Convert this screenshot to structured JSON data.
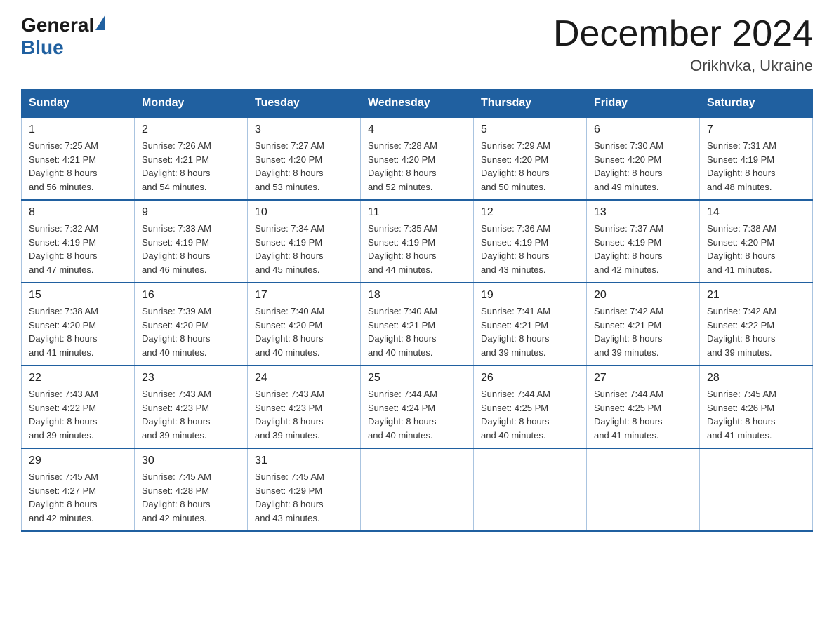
{
  "logo": {
    "general": "General",
    "blue": "Blue",
    "triangle": "▶"
  },
  "title": "December 2024",
  "location": "Orikhvka, Ukraine",
  "days_of_week": [
    "Sunday",
    "Monday",
    "Tuesday",
    "Wednesday",
    "Thursday",
    "Friday",
    "Saturday"
  ],
  "weeks": [
    [
      {
        "day": "1",
        "sunrise": "7:25 AM",
        "sunset": "4:21 PM",
        "daylight": "8 hours and 56 minutes."
      },
      {
        "day": "2",
        "sunrise": "7:26 AM",
        "sunset": "4:21 PM",
        "daylight": "8 hours and 54 minutes."
      },
      {
        "day": "3",
        "sunrise": "7:27 AM",
        "sunset": "4:20 PM",
        "daylight": "8 hours and 53 minutes."
      },
      {
        "day": "4",
        "sunrise": "7:28 AM",
        "sunset": "4:20 PM",
        "daylight": "8 hours and 52 minutes."
      },
      {
        "day": "5",
        "sunrise": "7:29 AM",
        "sunset": "4:20 PM",
        "daylight": "8 hours and 50 minutes."
      },
      {
        "day": "6",
        "sunrise": "7:30 AM",
        "sunset": "4:20 PM",
        "daylight": "8 hours and 49 minutes."
      },
      {
        "day": "7",
        "sunrise": "7:31 AM",
        "sunset": "4:19 PM",
        "daylight": "8 hours and 48 minutes."
      }
    ],
    [
      {
        "day": "8",
        "sunrise": "7:32 AM",
        "sunset": "4:19 PM",
        "daylight": "8 hours and 47 minutes."
      },
      {
        "day": "9",
        "sunrise": "7:33 AM",
        "sunset": "4:19 PM",
        "daylight": "8 hours and 46 minutes."
      },
      {
        "day": "10",
        "sunrise": "7:34 AM",
        "sunset": "4:19 PM",
        "daylight": "8 hours and 45 minutes."
      },
      {
        "day": "11",
        "sunrise": "7:35 AM",
        "sunset": "4:19 PM",
        "daylight": "8 hours and 44 minutes."
      },
      {
        "day": "12",
        "sunrise": "7:36 AM",
        "sunset": "4:19 PM",
        "daylight": "8 hours and 43 minutes."
      },
      {
        "day": "13",
        "sunrise": "7:37 AM",
        "sunset": "4:19 PM",
        "daylight": "8 hours and 42 minutes."
      },
      {
        "day": "14",
        "sunrise": "7:38 AM",
        "sunset": "4:20 PM",
        "daylight": "8 hours and 41 minutes."
      }
    ],
    [
      {
        "day": "15",
        "sunrise": "7:38 AM",
        "sunset": "4:20 PM",
        "daylight": "8 hours and 41 minutes."
      },
      {
        "day": "16",
        "sunrise": "7:39 AM",
        "sunset": "4:20 PM",
        "daylight": "8 hours and 40 minutes."
      },
      {
        "day": "17",
        "sunrise": "7:40 AM",
        "sunset": "4:20 PM",
        "daylight": "8 hours and 40 minutes."
      },
      {
        "day": "18",
        "sunrise": "7:40 AM",
        "sunset": "4:21 PM",
        "daylight": "8 hours and 40 minutes."
      },
      {
        "day": "19",
        "sunrise": "7:41 AM",
        "sunset": "4:21 PM",
        "daylight": "8 hours and 39 minutes."
      },
      {
        "day": "20",
        "sunrise": "7:42 AM",
        "sunset": "4:21 PM",
        "daylight": "8 hours and 39 minutes."
      },
      {
        "day": "21",
        "sunrise": "7:42 AM",
        "sunset": "4:22 PM",
        "daylight": "8 hours and 39 minutes."
      }
    ],
    [
      {
        "day": "22",
        "sunrise": "7:43 AM",
        "sunset": "4:22 PM",
        "daylight": "8 hours and 39 minutes."
      },
      {
        "day": "23",
        "sunrise": "7:43 AM",
        "sunset": "4:23 PM",
        "daylight": "8 hours and 39 minutes."
      },
      {
        "day": "24",
        "sunrise": "7:43 AM",
        "sunset": "4:23 PM",
        "daylight": "8 hours and 39 minutes."
      },
      {
        "day": "25",
        "sunrise": "7:44 AM",
        "sunset": "4:24 PM",
        "daylight": "8 hours and 40 minutes."
      },
      {
        "day": "26",
        "sunrise": "7:44 AM",
        "sunset": "4:25 PM",
        "daylight": "8 hours and 40 minutes."
      },
      {
        "day": "27",
        "sunrise": "7:44 AM",
        "sunset": "4:25 PM",
        "daylight": "8 hours and 41 minutes."
      },
      {
        "day": "28",
        "sunrise": "7:45 AM",
        "sunset": "4:26 PM",
        "daylight": "8 hours and 41 minutes."
      }
    ],
    [
      {
        "day": "29",
        "sunrise": "7:45 AM",
        "sunset": "4:27 PM",
        "daylight": "8 hours and 42 minutes."
      },
      {
        "day": "30",
        "sunrise": "7:45 AM",
        "sunset": "4:28 PM",
        "daylight": "8 hours and 42 minutes."
      },
      {
        "day": "31",
        "sunrise": "7:45 AM",
        "sunset": "4:29 PM",
        "daylight": "8 hours and 43 minutes."
      },
      null,
      null,
      null,
      null
    ]
  ],
  "labels": {
    "sunrise": "Sunrise:",
    "sunset": "Sunset:",
    "daylight": "Daylight:"
  }
}
